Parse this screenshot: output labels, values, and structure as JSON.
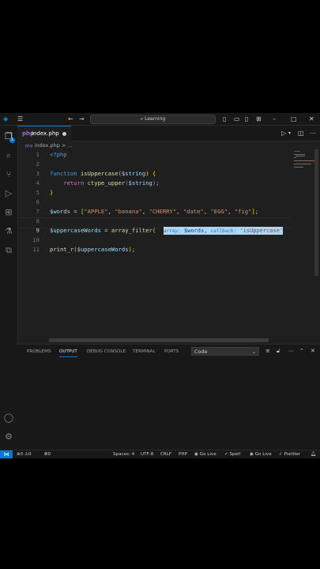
{
  "titlebar": {
    "search_text": "Learning",
    "menu_icon": "hamburger-icon",
    "back_icon": "arrow-left-icon",
    "forward_icon": "arrow-right-icon"
  },
  "activity_bar": {
    "items": [
      "explorer-icon",
      "search-icon",
      "source-control-icon",
      "run-debug-icon",
      "extensions-icon",
      "testing-icon",
      "python-icon"
    ],
    "explorer_badge": "1",
    "bottom": [
      "account-icon",
      "settings-icon"
    ]
  },
  "tab": {
    "name": "index.php",
    "icon": "php-file-icon"
  },
  "breadcrumb": {
    "file": "index.php",
    "sep": "> ..."
  },
  "editor": {
    "lines": [
      {
        "n": "1"
      },
      {
        "n": "2"
      },
      {
        "n": "3"
      },
      {
        "n": "4"
      },
      {
        "n": "5"
      },
      {
        "n": "6"
      },
      {
        "n": "7"
      },
      {
        "n": "8"
      },
      {
        "n": "9"
      },
      {
        "n": "10"
      },
      {
        "n": "11"
      }
    ],
    "php_open": "<?php",
    "function_kw": "function",
    "function_name": "isUppercase",
    "param": "$string",
    "return_kw": "return",
    "ctype": "ctype_upper",
    "words_var": "$words",
    "words_values": [
      "\"APPLE\"",
      "\"banana\"",
      "\"CHERRY\"",
      "\"date\"",
      "\"EGG\"",
      "\"fig\""
    ],
    "upper_var": "$uppercaseWords",
    "array_filter": "array_filter",
    "hint_array_label": "array:",
    "hint_callback_label": "callback:",
    "hint_callback_value": "'isUppercase'",
    "print_r": "print_r"
  },
  "panel": {
    "tabs": [
      "PROBLEMS",
      "OUTPUT",
      "DEBUG CONSOLE",
      "TERMINAL",
      "PORTS"
    ],
    "active_tab": "OUTPUT",
    "select_value": "Code"
  },
  "statusbar": {
    "errors": "0",
    "warnings": "0",
    "ports": "0",
    "spaces": "Spaces: 4",
    "encoding": "UTF-8",
    "eol": "CRLF",
    "language": "PHP",
    "golive1": "Go Live",
    "spell": "Spell",
    "golive2": "Go Live",
    "prettier": "Prettier"
  }
}
